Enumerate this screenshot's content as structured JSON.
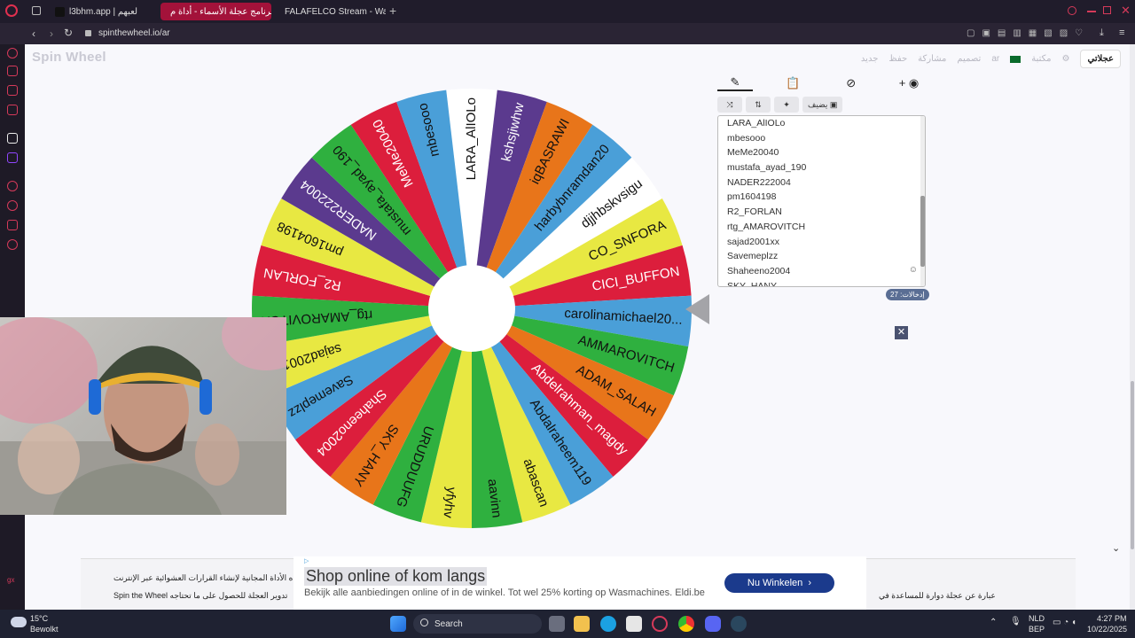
{
  "browser": {
    "tabs": [
      {
        "label": "l3bhm.app | لعبهم",
        "active": false
      },
      {
        "label": "برنامج عجلة الأسماء - أداة م",
        "active": true
      },
      {
        "label": "FALAFELCO Stream - Wa",
        "active": false
      }
    ],
    "new_tab_label": "+",
    "url": "spinthewheel.io/ar"
  },
  "site": {
    "logo": "Spin Wheel",
    "nav": [
      "جديد",
      "حفظ",
      "مشاركة",
      "تصميم",
      "ar",
      "مكتبة"
    ],
    "start_button": "عجلاتي"
  },
  "editor": {
    "tool_icons": [
      "pencil-icon",
      "clipboard-icon",
      "eye-off-icon",
      "plus-color-icon"
    ],
    "add_label": "يضيف",
    "entries_visible": [
      "LARA_AlIOLo",
      "mbesooo",
      "MeMe20040",
      "mustafa_ayad_190",
      "NADER222004",
      "pm1604198",
      "R2_FORLAN",
      "rtg_AMAROVITCH",
      "sajad2001xx",
      "Savemeplzz",
      "Shaheeno2004",
      "SKY_HANY"
    ],
    "count_label": "إدخالات: 27"
  },
  "wheel": {
    "segments": [
      {
        "label": "LARA_AlIOLo",
        "color": "#ffffff",
        "text": "#111"
      },
      {
        "label": "kshsjiwhw",
        "color": "#5b3a8e",
        "text": "#fff"
      },
      {
        "label": "iqBASRAWI",
        "color": "#e8751a",
        "text": "#111"
      },
      {
        "label": "harbybnramdan20",
        "color": "#4a9fd8",
        "text": "#111"
      },
      {
        "label": "djjhbskvsigu",
        "color": "#ffffff",
        "text": "#111"
      },
      {
        "label": "CO_SNFORA",
        "color": "#e8e842",
        "text": "#111"
      },
      {
        "label": "CICI_BUFFON",
        "color": "#dc1e3c",
        "text": "#fff"
      },
      {
        "label": "carolinamichael20...",
        "color": "#4a9fd8",
        "text": "#111"
      },
      {
        "label": "AMMAROVITCH",
        "color": "#2fb03f",
        "text": "#111"
      },
      {
        "label": "ADAM_SALAH",
        "color": "#e8751a",
        "text": "#111"
      },
      {
        "label": "Abdelrahman_magdy",
        "color": "#dc1e3c",
        "text": "#fff"
      },
      {
        "label": "Abdalraheem119",
        "color": "#4a9fd8",
        "text": "#111"
      },
      {
        "label": "abascan",
        "color": "#e8e842",
        "text": "#111"
      },
      {
        "label": "aavinn",
        "color": "#2fb03f",
        "text": "#111"
      },
      {
        "label": "yfyhv",
        "color": "#e8e842",
        "text": "#111"
      },
      {
        "label": "URUDDUUFG",
        "color": "#2fb03f",
        "text": "#111"
      },
      {
        "label": "SKY_HANY",
        "color": "#e8751a",
        "text": "#111"
      },
      {
        "label": "Shaheeno2004",
        "color": "#dc1e3c",
        "text": "#fff"
      },
      {
        "label": "Savemeplzz",
        "color": "#4a9fd8",
        "text": "#111"
      },
      {
        "label": "sajad2001xx",
        "color": "#e8e842",
        "text": "#111"
      },
      {
        "label": "rtg_AMAROVITCH",
        "color": "#2fb03f",
        "text": "#111"
      },
      {
        "label": "R2_FORLAN",
        "color": "#dc1e3c",
        "text": "#fff"
      },
      {
        "label": "pm1604198",
        "color": "#e8e842",
        "text": "#111"
      },
      {
        "label": "NADER222004",
        "color": "#5b3a8e",
        "text": "#fff"
      },
      {
        "label": "mustafa_ayad_190",
        "color": "#2fb03f",
        "text": "#111"
      },
      {
        "label": "MeMe20040",
        "color": "#dc1e3c",
        "text": "#fff"
      },
      {
        "label": "mbesooo",
        "color": "#4a9fd8",
        "text": "#111"
      }
    ]
  },
  "banner": {
    "line1": "ه الأداة المجانية لإنشاء القرارات العشوائية عبر الإنترنت",
    "line2": "Spin the Wheel تدوير العجلة للحصول على ما تحتاجه",
    "line3": "عبارة عن عجلة دوارة للمساعدة في"
  },
  "ad": {
    "title": "Shop online of kom langs",
    "description": "Bekijk alle aanbiedingen online of in de winkel. Tot wel 25% korting op Wasmachines. Eldi.be",
    "button": "Nu Winkelen"
  },
  "taskbar": {
    "weather_temp": "15°C",
    "weather_text": "Bewolkt",
    "search": "Search",
    "lang": "NLD",
    "lang2": "BEP",
    "time": "4:27 PM",
    "date": "10/22/2025"
  }
}
